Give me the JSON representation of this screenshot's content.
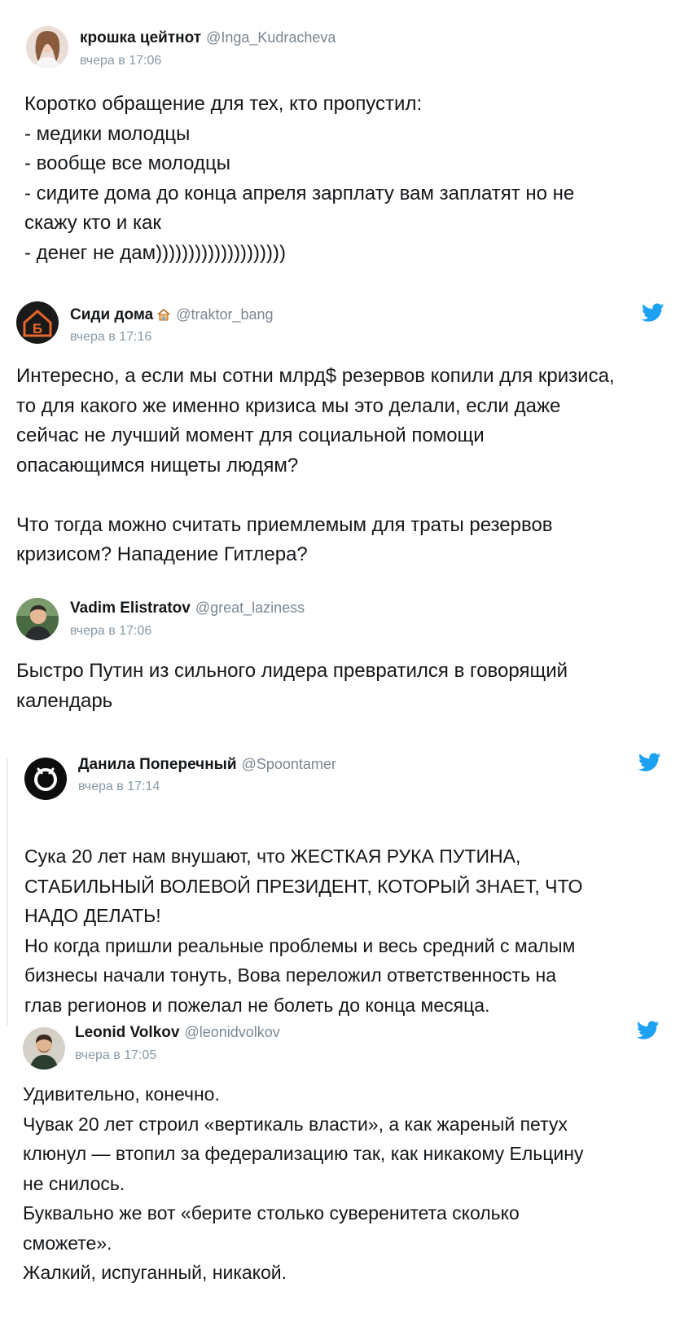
{
  "tweets": [
    {
      "name": "крошка цейтнот",
      "handle": "@Inga_Kudracheva",
      "time": "вчера в 17:06",
      "avatar_icon": "user-photo-avatar",
      "text": "Коротко обращение для тех, кто пропустил:\n- медики молодцы\n- вообще все молодцы\n- сидите дома до конца апреля зарплату вам заплатят но не\nскажу кто и как\n- денег не дам))))))))))))))))))))"
    },
    {
      "name": "Сиди дома",
      "name_emoji": "house-icon",
      "handle": "@traktor_bang",
      "time": "вчера в 17:16",
      "avatar_icon": "letter-b-house-avatar",
      "text": "Интересно, а если мы сотни млрд$ резервов копили для кризиса,\nто для какого же именно кризиса мы это делали, если даже\nсейчас не лучший момент для социальной помощи\nопасающимся нищеты людям?\n\nЧто тогда можно считать приемлемым для траты резервов\nкризисом? Нападение Гитлера?"
    },
    {
      "name": "Vadim Elistratov",
      "handle": "@great_laziness",
      "time": "вчера в 17:06",
      "avatar_icon": "user-photo-avatar",
      "text": "Быстро Путин из сильного лидера превратился в говорящий\nкалендарь"
    },
    {
      "name": "Данила Поперечный",
      "handle": "@Spoontamer",
      "time": "вчера в 17:14",
      "avatar_icon": "ring-logo-avatar",
      "text": "Сука 20 лет нам внушают, что ЖЕСТКАЯ РУКА ПУТИНА,\nСТАБИЛЬНЫЙ ВОЛЕВОЙ ПРЕЗИДЕНТ, КОТОРЫЙ ЗНАЕТ, ЧТО\nНАДО ДЕЛАТЬ!\nНо когда пришли реальные проблемы и весь средний с малым\nбизнесы начали тонуть, Вова переложил ответственность на\nглав регионов и пожелал не болеть до конца месяца."
    },
    {
      "name": "Leonid Volkov",
      "handle": "@leonidvolkov",
      "time": "вчера в 17:05",
      "avatar_icon": "user-photo-avatar",
      "text": "Удивительно, конечно.\nЧувак 20 лет строил «вертикаль власти», а как жареный петух\nклюнул — втопил за федерализацию так, как никакому Ельцину\nне снилось.\nБуквально же вот «берите столько суверенитета сколько\nсможете».\nЖалкий, испуганный, никакой."
    }
  ],
  "colors": {
    "twitter_blue": "#1da1f2",
    "text": "#14171a",
    "meta": "#8899a6"
  }
}
